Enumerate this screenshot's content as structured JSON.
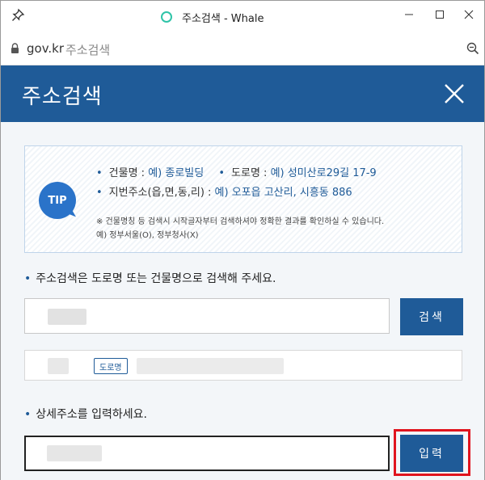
{
  "window": {
    "title": "주소검색 - Whale",
    "controls": [
      "minimize",
      "maximize",
      "close"
    ]
  },
  "address_bar": {
    "host": "gov.kr",
    "path": "주소검색"
  },
  "header": {
    "title": "주소검색"
  },
  "tip": {
    "badge": "TIP",
    "line1_a_label": "건물명 : ",
    "line1_a_value": "예) 종로빌딩",
    "line1_b_label": "도로명 : ",
    "line1_b_value": "예) 성미산로29길 17-9",
    "line2_label": "지번주소(읍,면,동,리) : ",
    "line2_value": "예) 오포읍 고산리, 시흥동 886",
    "note1": "※ 건물명칭 등 검색시 시작글자부터 검색하셔야 정확한 결과를 확인하실 수 있습니다.",
    "note2": "예) 정부서울(O), 정부청사(X)"
  },
  "search": {
    "label": "주소검색은 도로명 또는 건물명으로 검색해 주세요.",
    "button": "검색"
  },
  "result": {
    "badge": "도로명"
  },
  "detail": {
    "label": "상세주소를 입력하세요.",
    "button": "입력"
  },
  "colors": {
    "primary": "#1f5b98",
    "tip_circle": "#2a73c9",
    "highlight": "#e0141e",
    "whale_accent": "#2fc4a8"
  }
}
